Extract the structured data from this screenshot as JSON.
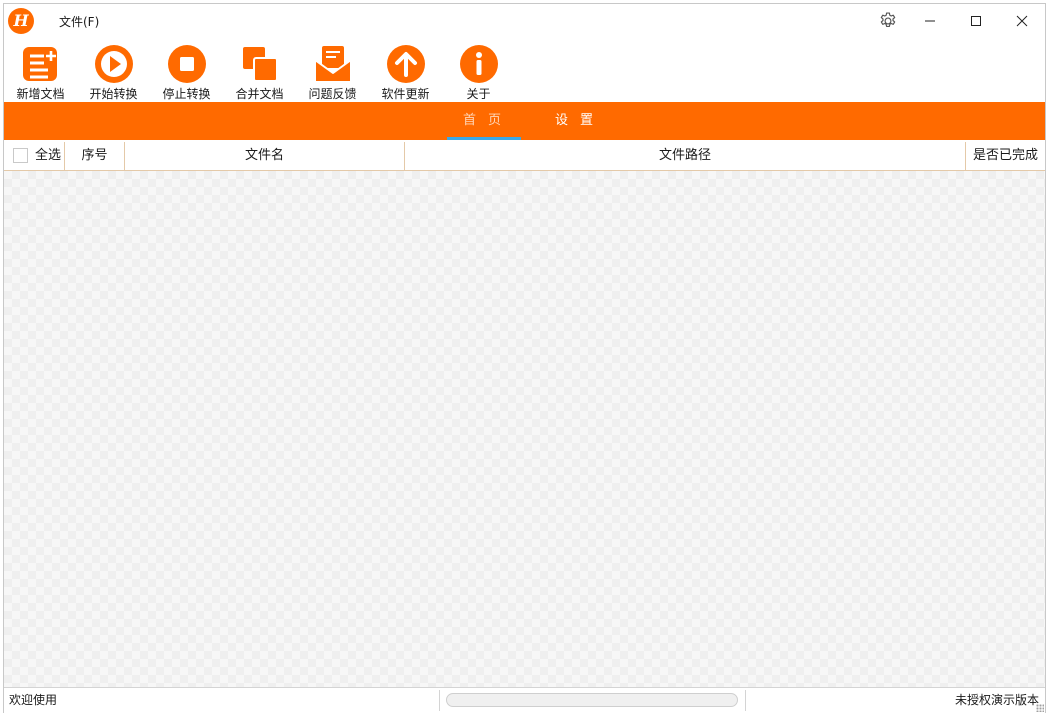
{
  "window": {
    "logo_letter": "H",
    "menu": {
      "file_label": "文件(F)"
    }
  },
  "toolbar": {
    "items": [
      {
        "label": "新增文档",
        "icon": "add-document-icon"
      },
      {
        "label": "开始转换",
        "icon": "play-icon"
      },
      {
        "label": "停止转换",
        "icon": "stop-icon"
      },
      {
        "label": "合并文档",
        "icon": "merge-icon"
      },
      {
        "label": "问题反馈",
        "icon": "feedback-mail-icon"
      },
      {
        "label": "软件更新",
        "icon": "update-arrow-icon"
      },
      {
        "label": "关于",
        "icon": "info-icon"
      }
    ]
  },
  "nav": {
    "tabs": [
      {
        "label": "首页",
        "active": true
      },
      {
        "label": "设置",
        "active": false
      }
    ]
  },
  "table": {
    "select_all_label": "全选",
    "columns": [
      "序号",
      "文件名",
      "文件路径",
      "是否已完成"
    ],
    "rows": []
  },
  "status": {
    "left_text": "欢迎使用",
    "progress": 0,
    "right_text": "未授权演示版本"
  },
  "colors": {
    "accent": "#ff6a00",
    "tab_underline": "#39a9e8"
  }
}
